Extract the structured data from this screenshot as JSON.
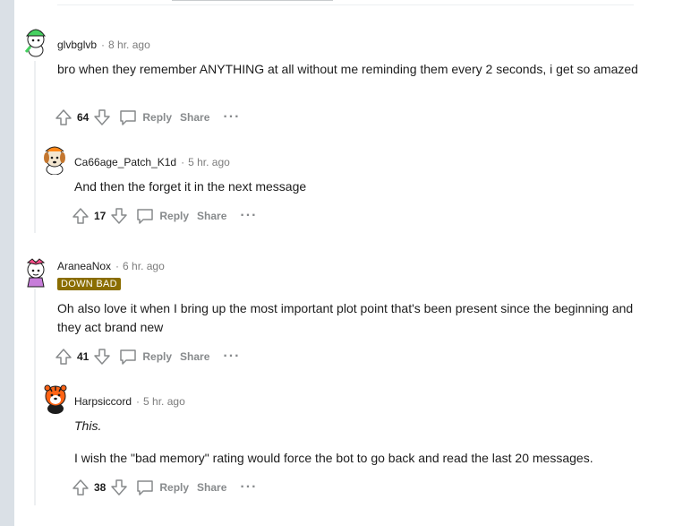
{
  "comments": [
    {
      "author": "glvbglvb",
      "time": "8 hr. ago",
      "body": [
        "bro when they remember ANYTHING at all without me reminding them every 2 seconds, i get so amazed"
      ],
      "votes": "64",
      "reply_label": "Reply",
      "share_label": "Share",
      "more_label": "···",
      "avatar_icon": "snoo-green-hat-avatar-icon"
    },
    {
      "author": "Ca66age_Patch_K1d",
      "time": "5 hr. ago",
      "body": [
        "And then the forget it in the next message"
      ],
      "votes": "17",
      "reply_label": "Reply",
      "share_label": "Share",
      "more_label": "···",
      "avatar_icon": "snoo-dog-avatar-icon"
    },
    {
      "author": "AraneaNox",
      "time": "6 hr. ago",
      "flair": "DOWN BAD",
      "body": [
        "Oh also love it when I bring up the most important plot point that's been present since the beginning and they act brand new"
      ],
      "votes": "41",
      "reply_label": "Reply",
      "share_label": "Share",
      "more_label": "···",
      "avatar_icon": "snoo-purple-bow-avatar-icon"
    },
    {
      "author": "Harpsiccord",
      "time": "5 hr. ago",
      "body": [
        "This.",
        "I wish the \"bad memory\" rating would force the bot to go back and read the last 20 messages."
      ],
      "votes": "38",
      "reply_label": "Reply",
      "share_label": "Share",
      "more_label": "···",
      "avatar_icon": "snoo-tiger-avatar-icon"
    }
  ],
  "colors": {
    "gutter": "#dae0e6",
    "meta_gray": "#7c7c7c",
    "action_gray": "#878a8c",
    "flair_bg": "#8a6d00",
    "thread_line": "#edeff1"
  }
}
